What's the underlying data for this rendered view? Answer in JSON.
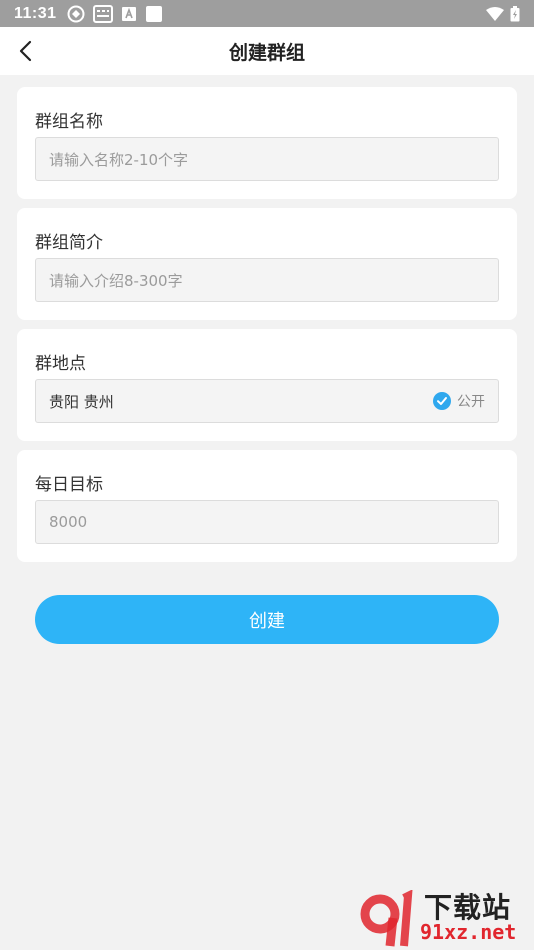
{
  "status_bar": {
    "time": "11:31",
    "icons": [
      "sync-icon",
      "keyboard-icon",
      "a-box-icon",
      "square-icon"
    ],
    "right_icons": [
      "wifi-icon",
      "battery-icon"
    ]
  },
  "app_bar": {
    "title": "创建群组",
    "back_icon": "back-arrow-icon"
  },
  "form": {
    "name": {
      "label": "群组名称",
      "placeholder": "请输入名称2-10个字"
    },
    "intro": {
      "label": "群组简介",
      "placeholder": "请输入介绍8-300字"
    },
    "location": {
      "label": "群地点",
      "value": "贵阳 贵州",
      "public_label": "公开",
      "public_checked": true
    },
    "daily_goal": {
      "label": "每日目标",
      "placeholder": "8000"
    }
  },
  "create_button": {
    "label": "创建"
  },
  "colors": {
    "accent": "#2eb4f7",
    "check": "#2fa8ee",
    "background": "#f2f2f2",
    "status_bar": "#9e9e9e"
  },
  "watermark": {
    "top": "下载站",
    "bottom": "91xz.net"
  }
}
